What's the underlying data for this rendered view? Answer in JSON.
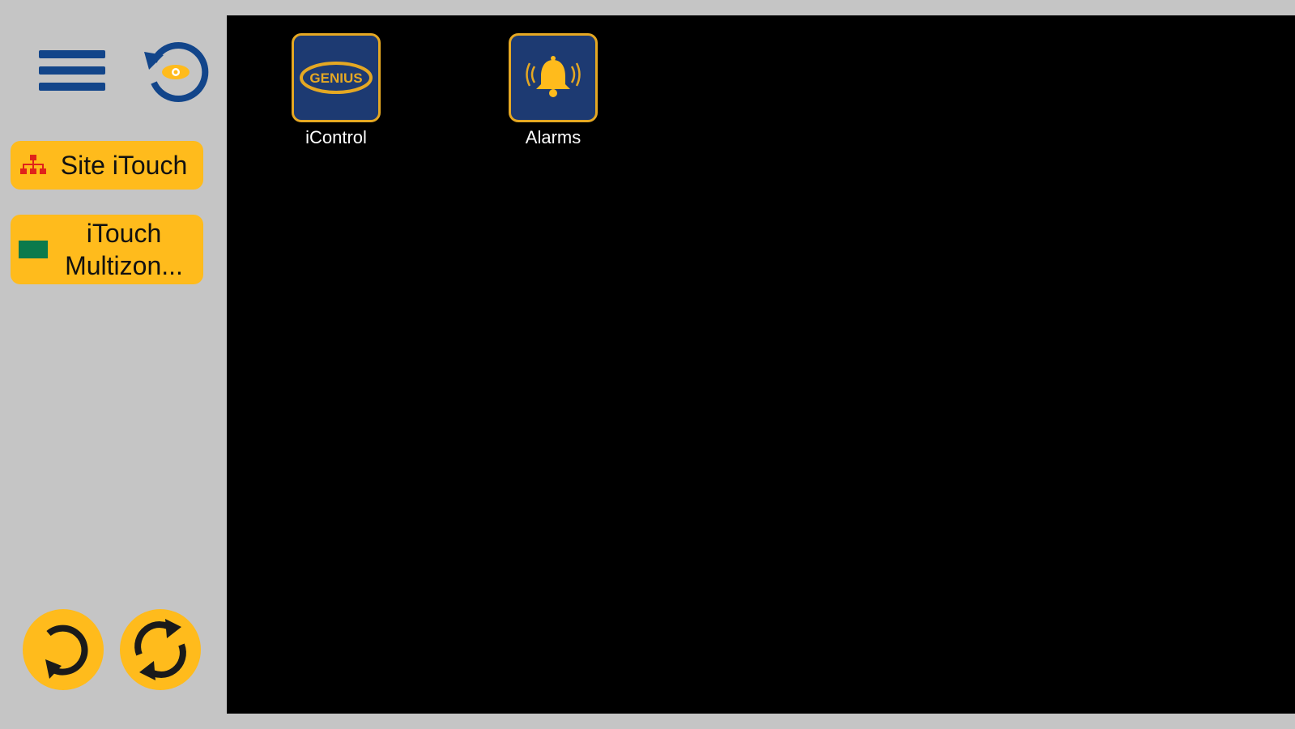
{
  "sidebar": {
    "menu_icon": "hamburger-menu-icon",
    "reset_icon": "reset-view-eye-icon",
    "nav": [
      {
        "label": "Site iTouch",
        "icon": "site-hierarchy-icon",
        "icon_color": "#e0231a"
      },
      {
        "label": "iTouch Multizon...",
        "icon": "multizone-panel-icon",
        "icon_color": "#0b7a4c"
      }
    ],
    "bottom_buttons": [
      {
        "icon": "undo-arrow-icon"
      },
      {
        "icon": "sync-refresh-icon"
      }
    ]
  },
  "canvas": {
    "apps": [
      {
        "label": "iControl",
        "icon": "genius-logo-icon",
        "logo_text": "GENIUS"
      },
      {
        "label": "Alarms",
        "icon": "alarm-bell-icon"
      }
    ]
  },
  "colors": {
    "background": "#c5c5c5",
    "accent_yellow": "#ffbb1c",
    "navy": "#12458a",
    "tile_blue": "#1d3a72",
    "tile_border": "#e5a823",
    "canvas": "#000000"
  }
}
